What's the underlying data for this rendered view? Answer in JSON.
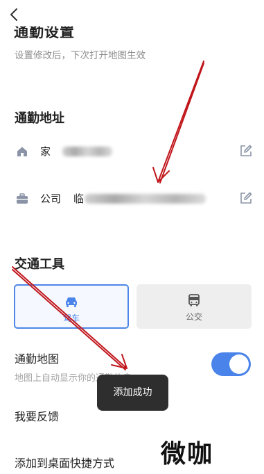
{
  "header": {
    "back_icon": "chevron-left-icon",
    "title": "通勤设置",
    "subtitle": "设置修改后，下次打开地图生效"
  },
  "commute_address": {
    "section_title": "通勤地址",
    "items": [
      {
        "icon": "home-icon",
        "label": "家",
        "edit_icon": "edit-icon"
      },
      {
        "icon": "briefcase-icon",
        "label": "公司",
        "value_prefix": "临",
        "edit_icon": "edit-icon"
      }
    ]
  },
  "transport": {
    "section_title": "交通工具",
    "options": [
      {
        "icon": "car-icon",
        "label": "驾车",
        "selected": true
      },
      {
        "icon": "bus-icon",
        "label": "公交",
        "selected": false
      }
    ]
  },
  "commute_map": {
    "title": "通勤地图",
    "description": "地图上自动显示你的通勤信息",
    "enabled": true
  },
  "toast": {
    "text": "添加成功"
  },
  "feedback": {
    "label": "我要反馈"
  },
  "shortcut": {
    "label": "添加到桌面快捷方式"
  },
  "watermark": {
    "text": "微咖"
  },
  "colors": {
    "accent": "#4a84ea",
    "annotation_arrow": "#c0161b",
    "toast_bg": "#2e2e2e",
    "muted_text": "#8e8e8e",
    "icon_gray": "#8a94a6"
  }
}
